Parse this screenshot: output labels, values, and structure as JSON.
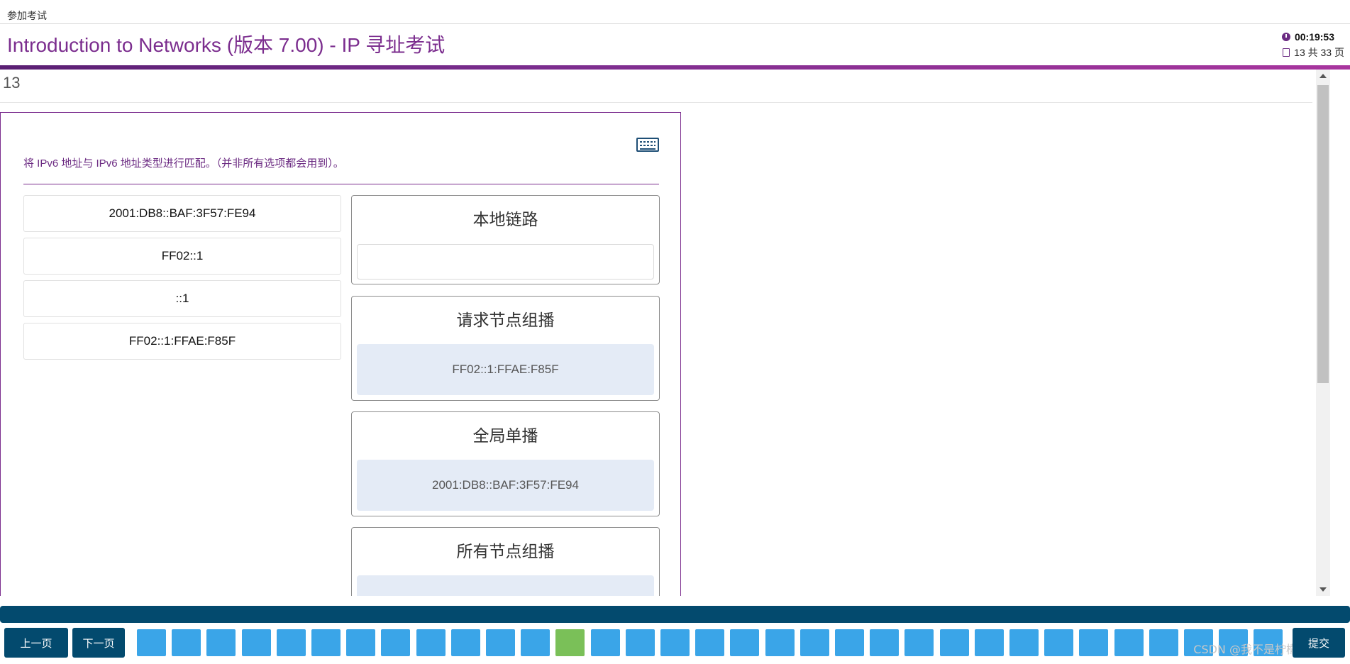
{
  "topbar": {
    "breadcrumb": "参加考试"
  },
  "header": {
    "title": "Introduction to Networks (版本 7.00) - IP 寻址考试",
    "timer": "00:19:53",
    "pages": "13 共 33 页"
  },
  "question": {
    "number": "13",
    "instruction": "将 IPv6 地址与 IPv6 地址类型进行匹配。（并非所有选项都会用到）。",
    "options": [
      {
        "label": "2001:DB8::BAF:3F57:FE94"
      },
      {
        "label": "FF02::1"
      },
      {
        "label": "::1"
      },
      {
        "label": "FF02::1:FFAE:F85F"
      }
    ],
    "targets": [
      {
        "label": "本地链路",
        "answer": ""
      },
      {
        "label": "请求节点组播",
        "answer": "FF02::1:FFAE:F85F"
      },
      {
        "label": "全局单播",
        "answer": "2001:DB8::BAF:3F57:FE94"
      },
      {
        "label": "所有节点组播",
        "answer": ""
      }
    ]
  },
  "nav": {
    "prev_label": "上一页",
    "next_label": "下一页",
    "submit_label": "提交",
    "current_page": 13,
    "page_count": 33
  },
  "watermark": "CSDN @我不是柠檬精",
  "colors": {
    "accent": "#7b2d8e",
    "nav": "#034a6e",
    "page_button": "#3aa5e8",
    "current_page_button": "#7ac058",
    "drop_filled": "#e4ebf6"
  }
}
